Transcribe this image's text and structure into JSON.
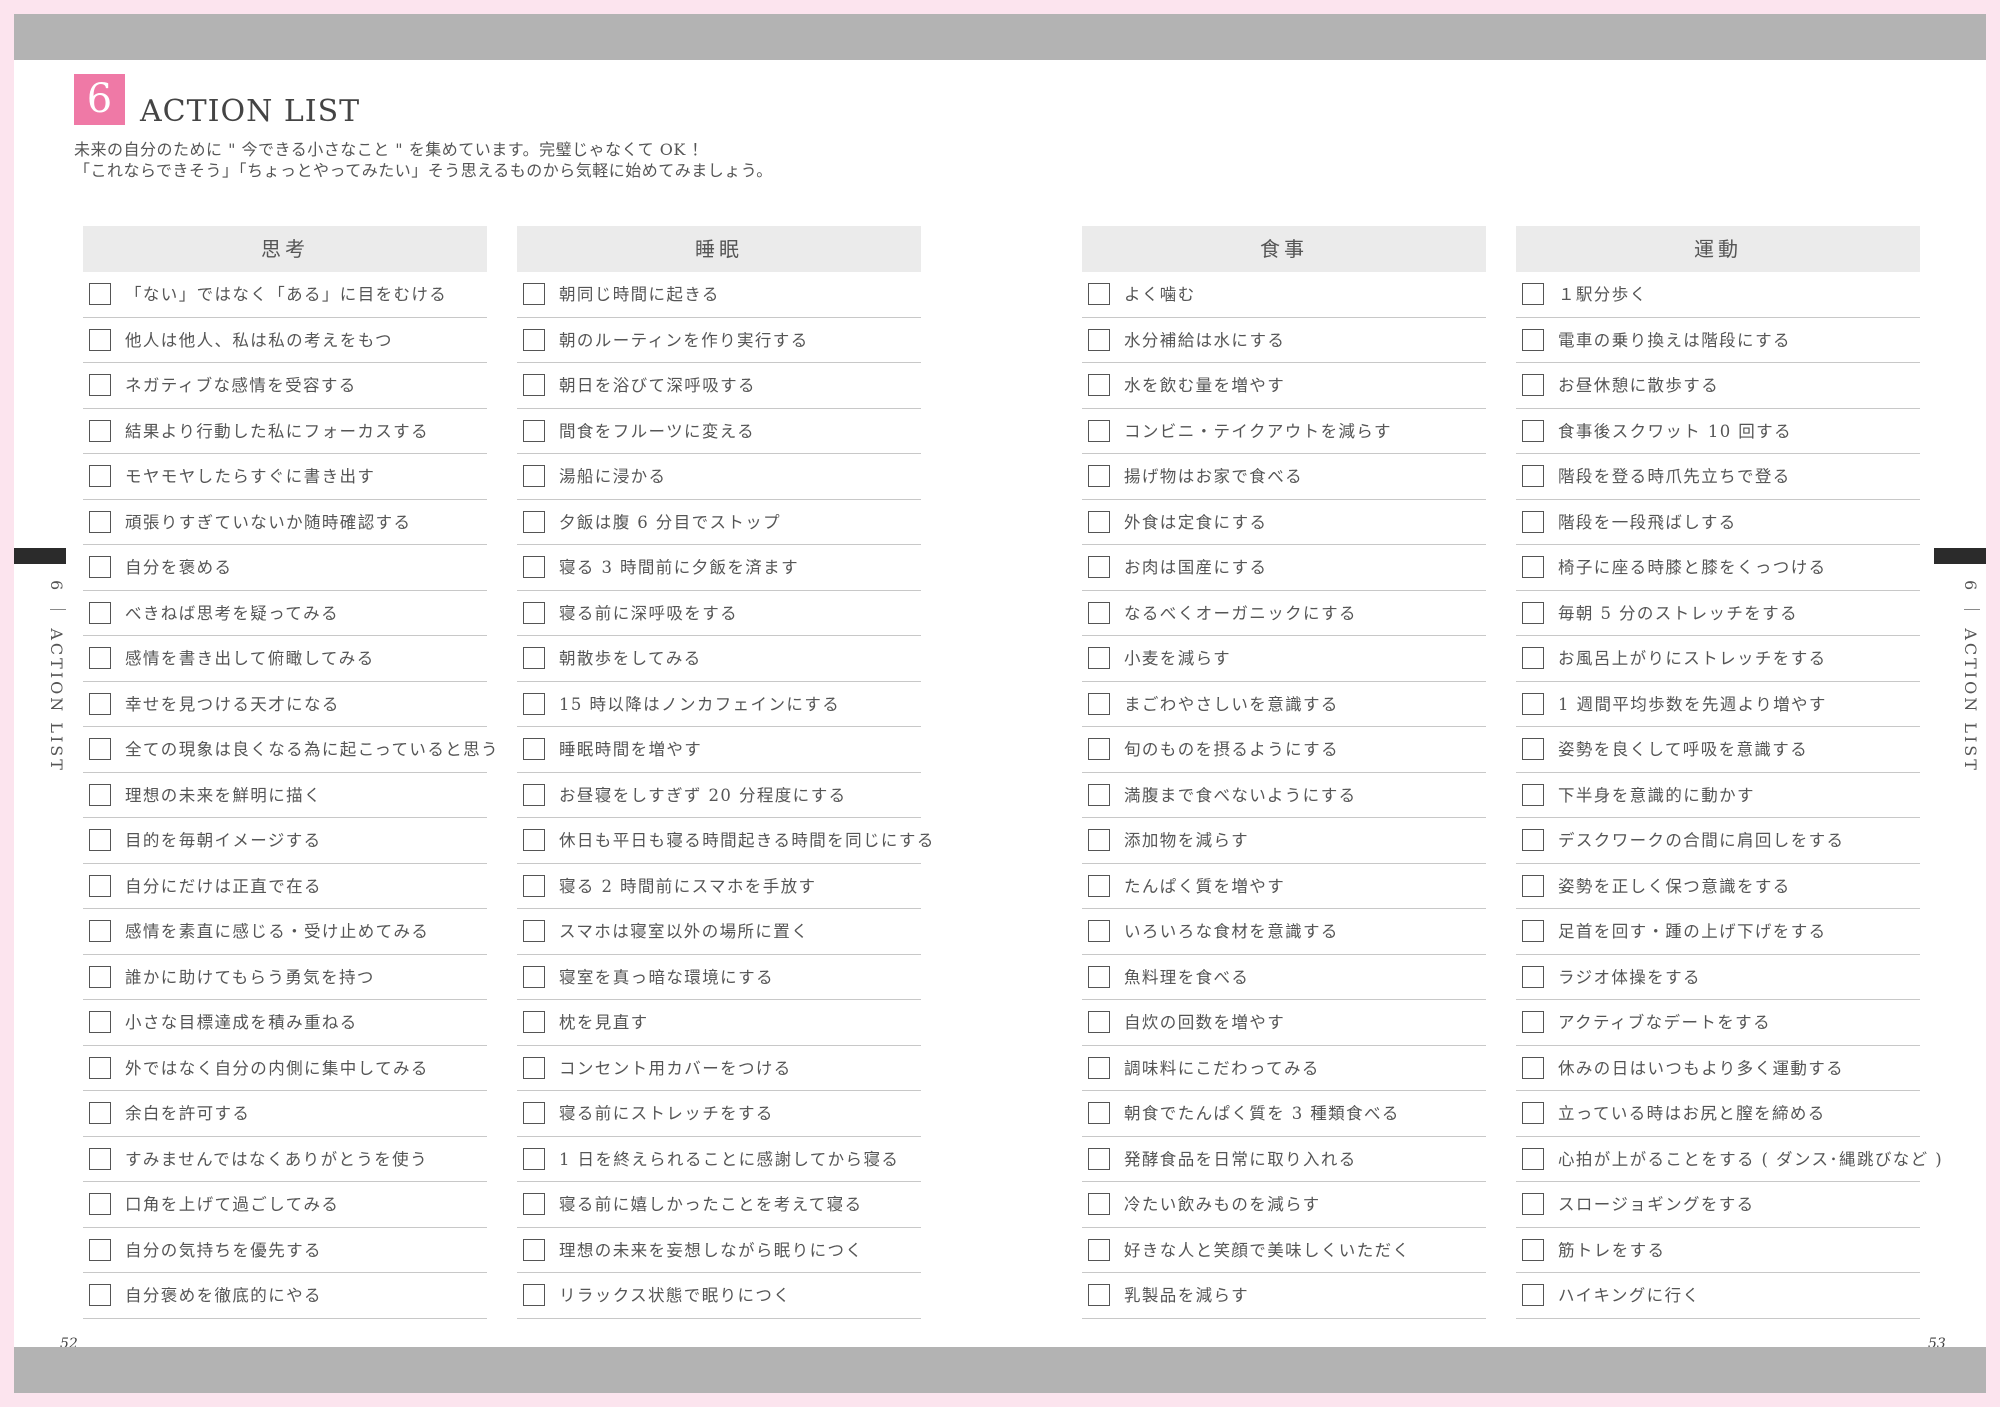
{
  "section": {
    "number": "6",
    "title": "ACTION LIST",
    "intro": [
      "未来の自分のために \" 今できる小さなこと \" を集めています。完璧じゃなくて OK ！",
      "「これならできそう」「ちょっとやってみたい」そう思えるものから気軽に始めてみましょう。"
    ]
  },
  "side_label": "6 ｜ ACTION LIST",
  "page_numbers": {
    "left": "52",
    "right": "53"
  },
  "colors": {
    "accent": "#ef79a6",
    "band": "#b3b3b3",
    "border": "#fce4ee"
  },
  "columns": [
    {
      "title": "思考",
      "items": [
        "「ない」ではなく「ある」に目をむける",
        "他人は他人、私は私の考えをもつ",
        "ネガティブな感情を受容する",
        "結果より行動した私にフォーカスする",
        "モヤモヤしたらすぐに書き出す",
        "頑張りすぎていないか随時確認する",
        "自分を褒める",
        "べきねば思考を疑ってみる",
        "感情を書き出して俯瞰してみる",
        "幸せを見つける天才になる",
        "全ての現象は良くなる為に起こっていると思う",
        "理想の未来を鮮明に描く",
        "目的を毎朝イメージする",
        "自分にだけは正直で在る",
        "感情を素直に感じる・受け止めてみる",
        "誰かに助けてもらう勇気を持つ",
        "小さな目標達成を積み重ねる",
        "外ではなく自分の内側に集中してみる",
        "余白を許可する",
        "すみませんではなくありがとうを使う",
        "口角を上げて過ごしてみる",
        "自分の気持ちを優先する",
        "自分褒めを徹底的にやる"
      ]
    },
    {
      "title": "睡眠",
      "items": [
        "朝同じ時間に起きる",
        "朝のルーティンを作り実行する",
        "朝日を浴びて深呼吸する",
        "間食をフルーツに変える",
        "湯船に浸かる",
        "夕飯は腹 6 分目でストップ",
        "寝る 3 時間前に夕飯を済ます",
        "寝る前に深呼吸をする",
        "朝散歩をしてみる",
        "15 時以降はノンカフェインにする",
        "睡眠時間を増やす",
        "お昼寝をしすぎず 20 分程度にする",
        "休日も平日も寝る時間起きる時間を同じにする",
        "寝る 2 時間前にスマホを手放す",
        "スマホは寝室以外の場所に置く",
        "寝室を真っ暗な環境にする",
        "枕を見直す",
        "コンセント用カバーをつける",
        "寝る前にストレッチをする",
        "1 日を終えられることに感謝してから寝る",
        "寝る前に嬉しかったことを考えて寝る",
        "理想の未来を妄想しながら眠りにつく",
        "リラックス状態で眠りにつく"
      ]
    },
    {
      "title": "食事",
      "items": [
        "よく噛む",
        "水分補給は水にする",
        "水を飲む量を増やす",
        "コンビニ・テイクアウトを減らす",
        "揚げ物はお家で食べる",
        "外食は定食にする",
        "お肉は国産にする",
        "なるべくオーガニックにする",
        "小麦を減らす",
        "まごわやさしいを意識する",
        "旬のものを摂るようにする",
        "満腹まで食べないようにする",
        "添加物を減らす",
        "たんぱく質を増やす",
        "いろいろな食材を意識する",
        "魚料理を食べる",
        "自炊の回数を増やす",
        "調味料にこだわってみる",
        "朝食でたんぱく質を 3 種類食べる",
        "発酵食品を日常に取り入れる",
        "冷たい飲みものを減らす",
        "好きな人と笑顔で美味しくいただく",
        "乳製品を減らす"
      ]
    },
    {
      "title": "運動",
      "items": [
        "１駅分歩く",
        "電車の乗り換えは階段にする",
        "お昼休憩に散歩する",
        "食事後スクワット 10 回する",
        "階段を登る時爪先立ちで登る",
        "階段を一段飛ばしする",
        "椅子に座る時膝と膝をくっつける",
        "毎朝 5 分のストレッチをする",
        "お風呂上がりにストレッチをする",
        "1 週間平均歩数を先週より増やす",
        "姿勢を良くして呼吸を意識する",
        "下半身を意識的に動かす",
        "デスクワークの合間に肩回しをする",
        "姿勢を正しく保つ意識をする",
        "足首を回す・踵の上げ下げをする",
        "ラジオ体操をする",
        "アクティブなデートをする",
        "休みの日はいつもより多く運動する",
        "立っている時はお尻と膣を締める",
        "心拍が上がることをする ( ダンス･縄跳びなど )",
        "スロージョギングをする",
        "筋トレをする",
        "ハイキングに行く"
      ]
    }
  ]
}
